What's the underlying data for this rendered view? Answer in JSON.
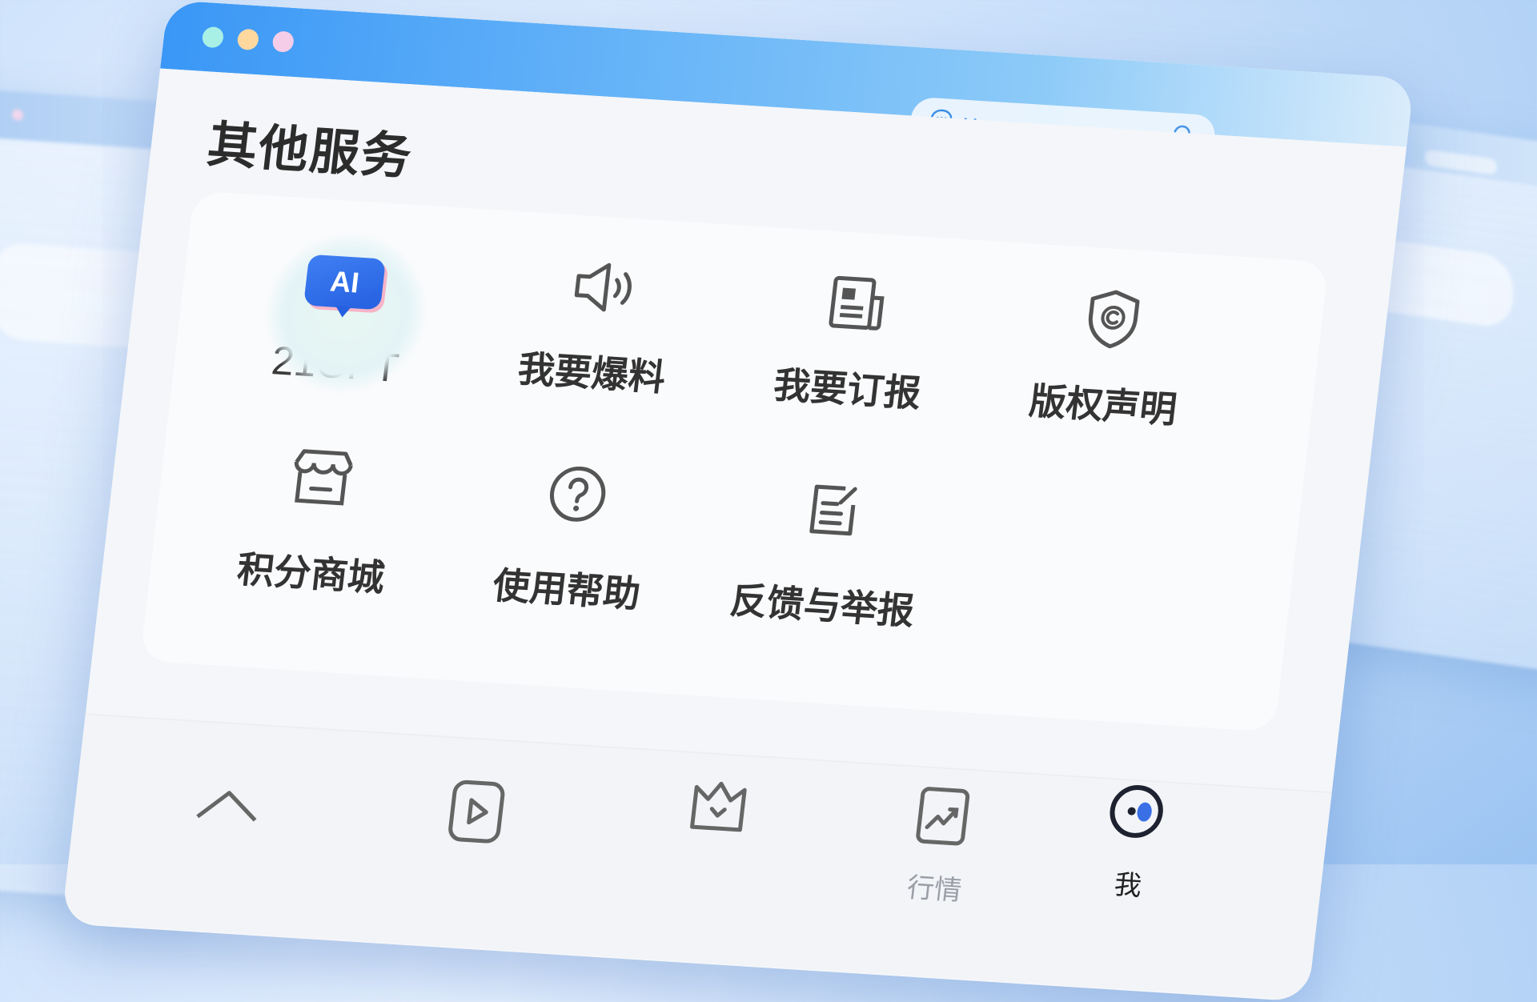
{
  "window": {
    "traffic_colors": [
      "#a8f0e6",
      "#ffd8a0",
      "#f6cde8"
    ],
    "accent": "#3a97f6"
  },
  "search": {
    "placeholder": "",
    "scope_icon": "chat-bubble-icon"
  },
  "page": {
    "title": "其他服务"
  },
  "services": [
    {
      "label": "21GPT",
      "icon": "ai-badge-icon",
      "badge": "AI"
    },
    {
      "label": "我要爆料",
      "icon": "speaker-icon"
    },
    {
      "label": "我要订报",
      "icon": "newspaper-icon"
    },
    {
      "label": "版权声明",
      "icon": "copyright-shield-icon"
    },
    {
      "label": "积分商城",
      "icon": "store-icon"
    },
    {
      "label": "使用帮助",
      "icon": "help-circle-icon"
    },
    {
      "label": "反馈与举报",
      "icon": "feedback-edit-icon"
    }
  ],
  "tabbar": {
    "items": [
      {
        "label": "",
        "icon": "home-icon"
      },
      {
        "label": "",
        "icon": "video-icon"
      },
      {
        "label": "",
        "icon": "crown-icon"
      },
      {
        "label": "行情",
        "icon": "chart-icon"
      },
      {
        "label": "我",
        "icon": "profile-icon",
        "active": true
      }
    ]
  }
}
